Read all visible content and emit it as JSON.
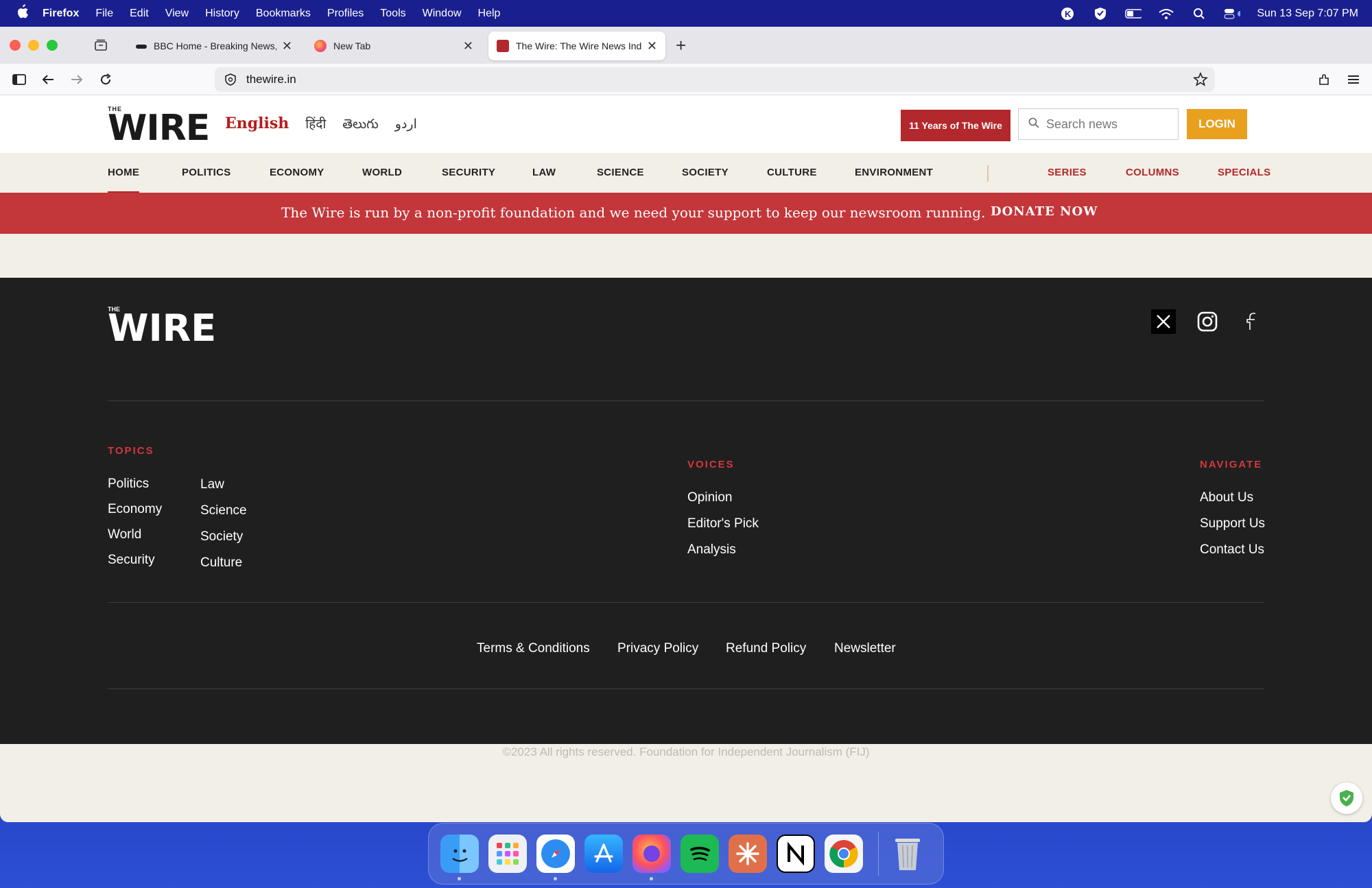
{
  "menubar": {
    "app": "Firefox",
    "items": [
      "File",
      "Edit",
      "View",
      "History",
      "Bookmarks",
      "Profiles",
      "Tools",
      "Window",
      "Help"
    ],
    "clock": "Sun 13 Sep  7:07 PM"
  },
  "tabs": [
    {
      "title": "BBC Home - Breaking News, W",
      "close": "✕"
    },
    {
      "title": "New Tab",
      "close": "✕"
    },
    {
      "title": "The Wire: The Wire News India,",
      "close": "✕"
    }
  ],
  "newtab": "+",
  "url": "thewire.in",
  "site": {
    "logo_small": "THE",
    "logo_word": "WIRE",
    "languages": [
      "English",
      "हिंदी",
      "తెలుగు",
      "اردو"
    ],
    "years_button": "11 Years of The Wire",
    "search_placeholder": "Search news",
    "login": "LOGIN",
    "categories": [
      "HOME",
      "POLITICS",
      "ECONOMY",
      "WORLD",
      "SECURITY",
      "LAW",
      "SCIENCE",
      "SOCIETY",
      "CULTURE",
      "ENVIRONMENT"
    ],
    "extra_categories": [
      "SERIES",
      "COLUMNS",
      "SPECIALS"
    ],
    "donate_message": "The Wire is run by a non-profit foundation and we need your support to keep our newsroom running.",
    "donate_button": "DONATE NOW"
  },
  "footer": {
    "topics_heading": "TOPICS",
    "topics_col1": [
      "Politics",
      "Economy",
      "World",
      "Security"
    ],
    "topics_col2": [
      "Law",
      "Science",
      "Society",
      "Culture"
    ],
    "voices_heading": "VOICES",
    "voices": [
      "Opinion",
      "Editor's Pick",
      "Analysis"
    ],
    "navigate_heading": "NAVIGATE",
    "navigate": [
      "About Us",
      "Support Us",
      "Contact Us"
    ],
    "legal": [
      "Terms & Conditions",
      "Privacy Policy",
      "Refund Policy",
      "Newsletter"
    ],
    "copyright": "©2023 All rights reserved. Foundation for Independent Journalism (FIJ)"
  },
  "colors": {
    "brand_red": "#b3282d",
    "login_orange": "#e8a01e",
    "footer_bg": "#1f1f1f"
  },
  "dock_apps": [
    "finder-icon",
    "launchpad-icon",
    "safari-icon",
    "app-store-icon",
    "firefox-icon",
    "spotify-icon",
    "claude-icon",
    "notion-icon",
    "chrome-icon",
    "trash-icon"
  ]
}
